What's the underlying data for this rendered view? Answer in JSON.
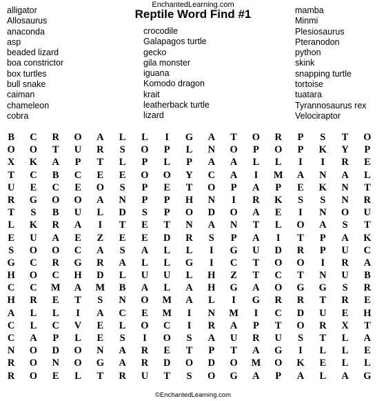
{
  "header": {
    "site_name": "EnchantedLearning.com",
    "title": "Reptile Word Find #1"
  },
  "word_list": {
    "columns": [
      {
        "name": "left",
        "words": [
          "alligator",
          "Allosaurus",
          "anaconda",
          "asp",
          "beaded lizard",
          "boa constrictor",
          "box turtles",
          "bull snake",
          "caiman",
          "chameleon",
          "cobra"
        ]
      },
      {
        "name": "middle",
        "words": [
          "crocodile",
          "Galapagos turtle",
          "gecko",
          "gila monster",
          "iguana",
          "Komodo dragon",
          "krait",
          "leatherback turtle",
          "lizard"
        ]
      },
      {
        "name": "right",
        "words": [
          "mamba",
          "Minmi",
          "Plesiosaurus",
          "Pteranodon",
          "python",
          "skink",
          "snapping turtle",
          "tortoise",
          "tuatara",
          "Tyrannosaurus rex",
          "Velociraptor"
        ]
      }
    ]
  },
  "grid": {
    "rows": 20,
    "cols": 17,
    "letters": [
      [
        "B",
        "C",
        "R",
        "O",
        "A",
        "L",
        "L",
        "I",
        "G",
        "A",
        "T",
        "O",
        "R",
        "P",
        "S",
        "T",
        "O"
      ],
      [
        "O",
        "O",
        "T",
        "U",
        "R",
        "S",
        "O",
        "P",
        "L",
        "N",
        "O",
        "P",
        "O",
        "P",
        "K",
        "Y",
        "P"
      ],
      [
        "X",
        "K",
        "A",
        "P",
        "T",
        "L",
        "P",
        "L",
        "P",
        "A",
        "A",
        "L",
        "L",
        "I",
        "I",
        "R",
        "E"
      ],
      [
        "T",
        "C",
        "B",
        "C",
        "E",
        "E",
        "O",
        "O",
        "Y",
        "C",
        "A",
        "I",
        "M",
        "A",
        "N",
        "A",
        "L"
      ],
      [
        "U",
        "E",
        "C",
        "E",
        "O",
        "S",
        "P",
        "E",
        "T",
        "O",
        "P",
        "A",
        "P",
        "E",
        "K",
        "N",
        "T"
      ],
      [
        "R",
        "G",
        "O",
        "O",
        "A",
        "N",
        "P",
        "P",
        "H",
        "N",
        "I",
        "R",
        "K",
        "S",
        "S",
        "N",
        "R"
      ],
      [
        "T",
        "S",
        "B",
        "U",
        "L",
        "D",
        "S",
        "P",
        "O",
        "D",
        "O",
        "A",
        "E",
        "I",
        "N",
        "O",
        "U"
      ],
      [
        "L",
        "K",
        "R",
        "A",
        "I",
        "T",
        "E",
        "T",
        "N",
        "A",
        "N",
        "T",
        "L",
        "O",
        "A",
        "S",
        "T"
      ],
      [
        "E",
        "U",
        "A",
        "E",
        "Z",
        "E",
        "E",
        "D",
        "R",
        "S",
        "P",
        "A",
        "I",
        "T",
        "P",
        "A",
        "K"
      ],
      [
        "S",
        "O",
        "O",
        "C",
        "A",
        "S",
        "A",
        "L",
        "L",
        "I",
        "G",
        "U",
        "D",
        "R",
        "P",
        "U",
        "C"
      ],
      [
        "G",
        "C",
        "R",
        "G",
        "R",
        "A",
        "L",
        "L",
        "G",
        "I",
        "C",
        "T",
        "O",
        "O",
        "I",
        "R",
        "A"
      ],
      [
        "H",
        "O",
        "C",
        "H",
        "D",
        "L",
        "U",
        "U",
        "L",
        "H",
        "Z",
        "T",
        "C",
        "T",
        "N",
        "U",
        "B"
      ],
      [
        "C",
        "C",
        "M",
        "A",
        "M",
        "B",
        "A",
        "L",
        "A",
        "H",
        "G",
        "A",
        "O",
        "G",
        "G",
        "S",
        "R"
      ],
      [
        "H",
        "R",
        "E",
        "T",
        "S",
        "N",
        "O",
        "M",
        "A",
        "L",
        "I",
        "G",
        "R",
        "R",
        "T",
        "R",
        "E"
      ],
      [
        "A",
        "L",
        "L",
        "I",
        "A",
        "C",
        "E",
        "M",
        "I",
        "N",
        "M",
        "I",
        "C",
        "D",
        "U",
        "E",
        "H"
      ],
      [
        "C",
        "L",
        "C",
        "V",
        "E",
        "L",
        "O",
        "C",
        "I",
        "R",
        "A",
        "P",
        "T",
        "O",
        "R",
        "X",
        "T"
      ],
      [
        "C",
        "A",
        "P",
        "L",
        "E",
        "S",
        "I",
        "O",
        "S",
        "A",
        "U",
        "R",
        "U",
        "S",
        "T",
        "L",
        "A"
      ],
      [
        "N",
        "O",
        "D",
        "O",
        "N",
        "A",
        "R",
        "E",
        "T",
        "P",
        "T",
        "A",
        "G",
        "I",
        "L",
        "L",
        "E"
      ],
      [
        "R",
        "O",
        "N",
        "O",
        "G",
        "A",
        "R",
        "D",
        "O",
        "D",
        "O",
        "M",
        "O",
        "K",
        "E",
        "L",
        "L"
      ],
      [
        "R",
        "O",
        "E",
        "L",
        "T",
        "R",
        "U",
        "T",
        "S",
        "O",
        "G",
        "A",
        "P",
        "A",
        "L",
        "A",
        "G"
      ]
    ]
  },
  "footer": {
    "copyright": "©EnchantedLearning.com"
  }
}
